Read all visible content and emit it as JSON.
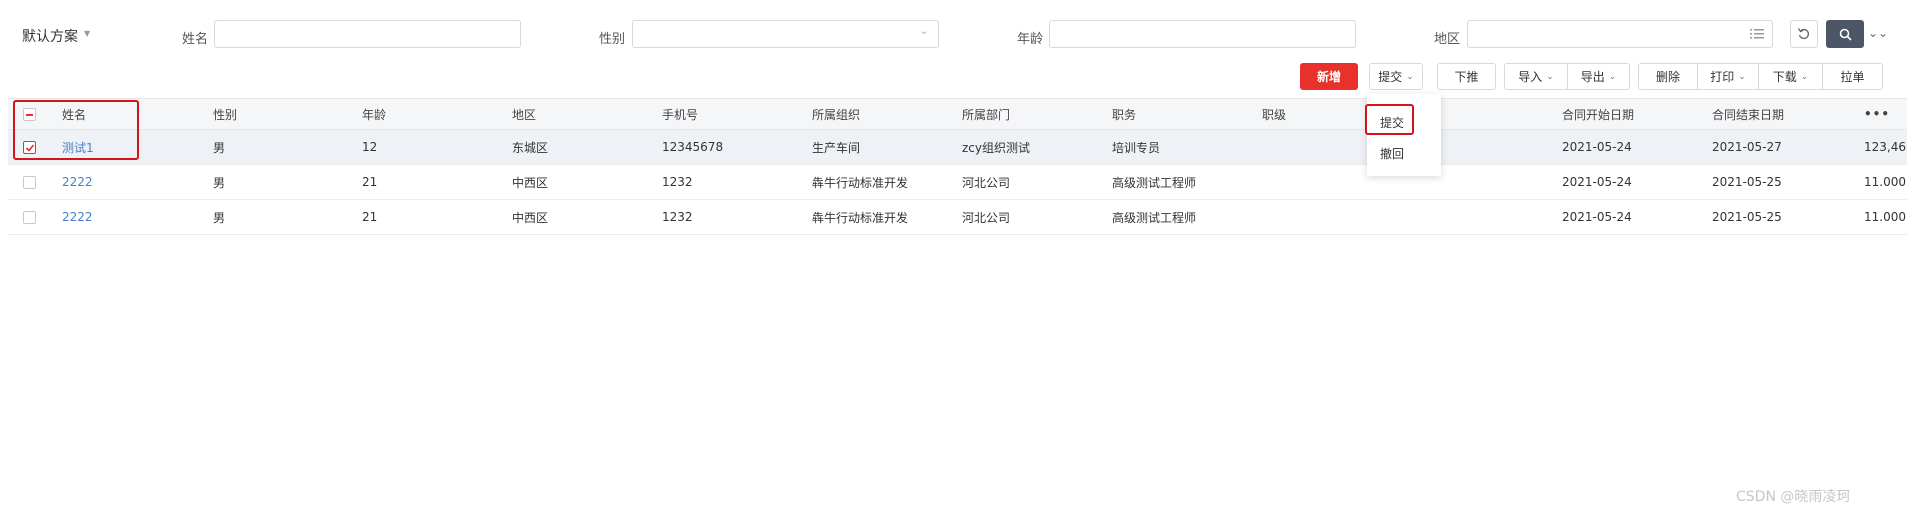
{
  "filter": {
    "scheme_label": "默认方案",
    "name_label": "姓名",
    "name_value": "",
    "gender_label": "性别",
    "gender_value": "",
    "age_label": "年龄",
    "age_value": "",
    "region_label": "地区",
    "region_value": ""
  },
  "toolbar": {
    "add": "新增",
    "submit": "提交",
    "push_down": "下推",
    "import": "导入",
    "export": "导出",
    "delete": "删除",
    "print": "打印",
    "download": "下载",
    "pull": "拉单"
  },
  "dropdown": {
    "items": [
      "提交",
      "撤回"
    ]
  },
  "table": {
    "headers": [
      "姓名",
      "性别",
      "年龄",
      "地区",
      "手机号",
      "所属组织",
      "所属部门",
      "职务",
      "职级",
      "合同开始日期",
      "合同结束日期",
      "•••"
    ],
    "rows": [
      {
        "name": "测试1",
        "gender": "男",
        "age": "12",
        "region": "东城区",
        "phone": "12345678",
        "org": "生产车间",
        "dept": "zcy组织测试",
        "title": "培训专员",
        "level": "",
        "start": "2021-05-24",
        "end": "2021-05-27",
        "extra": "123,46"
      },
      {
        "name": "2222",
        "gender": "男",
        "age": "21",
        "region": "中西区",
        "phone": "1232",
        "org": "犇牛行动标准开发",
        "dept": "河北公司",
        "title": "高级测试工程师",
        "level": "",
        "start": "2021-05-24",
        "end": "2021-05-25",
        "extra": "11.000"
      },
      {
        "name": "2222",
        "gender": "男",
        "age": "21",
        "region": "中西区",
        "phone": "1232",
        "org": "犇牛行动标准开发",
        "dept": "河北公司",
        "title": "高级测试工程师",
        "level": "",
        "start": "2021-05-24",
        "end": "2021-05-25",
        "extra": "11.000"
      }
    ]
  },
  "watermark": "CSDN @晓雨凌珂",
  "colors": {
    "primary": "#e8312a",
    "link": "#4a80c9",
    "highlight": "#d4141d",
    "search_button": "#4d5666"
  }
}
